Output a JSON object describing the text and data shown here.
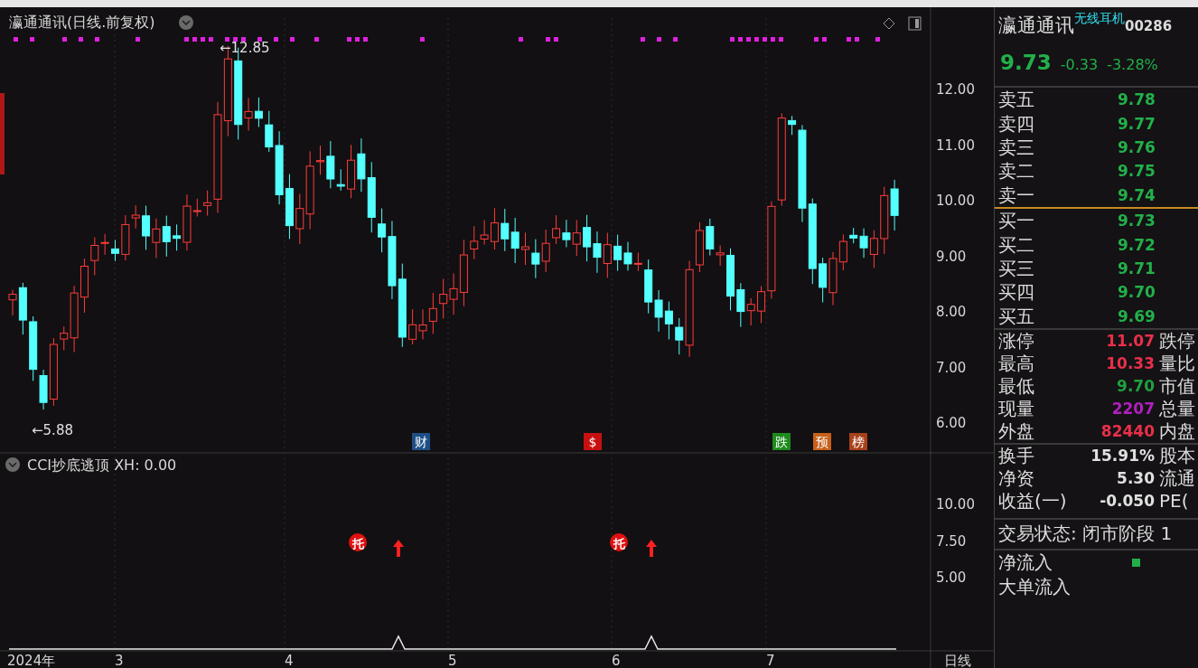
{
  "chart": {
    "title": "瀛通通讯(日线.前复权)",
    "price_ticks": [
      "12.00",
      "11.00",
      "10.00",
      "9.00",
      "8.00",
      "7.00",
      "6.00"
    ],
    "high_label": "←12.85",
    "low_label": "←5.88",
    "events": [
      {
        "text": "财",
        "color": "#1d4f86"
      },
      {
        "text": "$",
        "color": "#c81010"
      },
      {
        "text": "跌",
        "color": "#1e8a1e"
      },
      {
        "text": "预",
        "color": "#c8601a"
      },
      {
        "text": "榜",
        "color": "#a8401a"
      }
    ]
  },
  "indicator": {
    "title": "CCI抄底逃顶 XH: 0.00",
    "ticks": [
      "10.00",
      "7.50",
      "5.00"
    ],
    "signals": [
      "托",
      "托"
    ]
  },
  "time_axis": {
    "labels": [
      "2024年",
      "3",
      "4",
      "5",
      "6",
      "7"
    ],
    "period": "日线"
  },
  "quote": {
    "name": "瀛通通讯",
    "concept": "无线耳机",
    "code": "00286",
    "price": "9.73",
    "change": "-0.33",
    "change_pct": "-3.28%",
    "asks": [
      {
        "label": "卖五",
        "price": "9.78"
      },
      {
        "label": "卖四",
        "price": "9.77"
      },
      {
        "label": "卖三",
        "price": "9.76"
      },
      {
        "label": "卖二",
        "price": "9.75"
      },
      {
        "label": "卖一",
        "price": "9.74"
      }
    ],
    "bids": [
      {
        "label": "买一",
        "price": "9.73"
      },
      {
        "label": "买二",
        "price": "9.72"
      },
      {
        "label": "买三",
        "price": "9.71"
      },
      {
        "label": "买四",
        "price": "9.70"
      },
      {
        "label": "买五",
        "price": "9.69"
      }
    ],
    "stats": [
      {
        "label": "涨停",
        "value": "11.07",
        "color": "#e8304a",
        "right_label": "跌停"
      },
      {
        "label": "最高",
        "value": "10.33",
        "color": "#e8304a",
        "right_label": "量比"
      },
      {
        "label": "最低",
        "value": "9.70",
        "color": "#20a040",
        "right_label": "市值"
      },
      {
        "label": "现量",
        "value": "2207",
        "color": "#b020c0",
        "right_label": "总量"
      },
      {
        "label": "外盘",
        "value": "82440",
        "color": "#e8304a",
        "right_label": "内盘"
      }
    ],
    "finance": [
      {
        "label": "换手",
        "value": "15.91%",
        "right_label": "股本"
      },
      {
        "label": "净资",
        "value": "5.30",
        "right_label": "流通"
      },
      {
        "label": "收益(一)",
        "value": "-0.050",
        "right_label": "PE("
      }
    ],
    "status": "交易状态: 闭市阶段 1",
    "flows": [
      {
        "label": "净流入"
      },
      {
        "label": "大单流入"
      }
    ]
  }
}
